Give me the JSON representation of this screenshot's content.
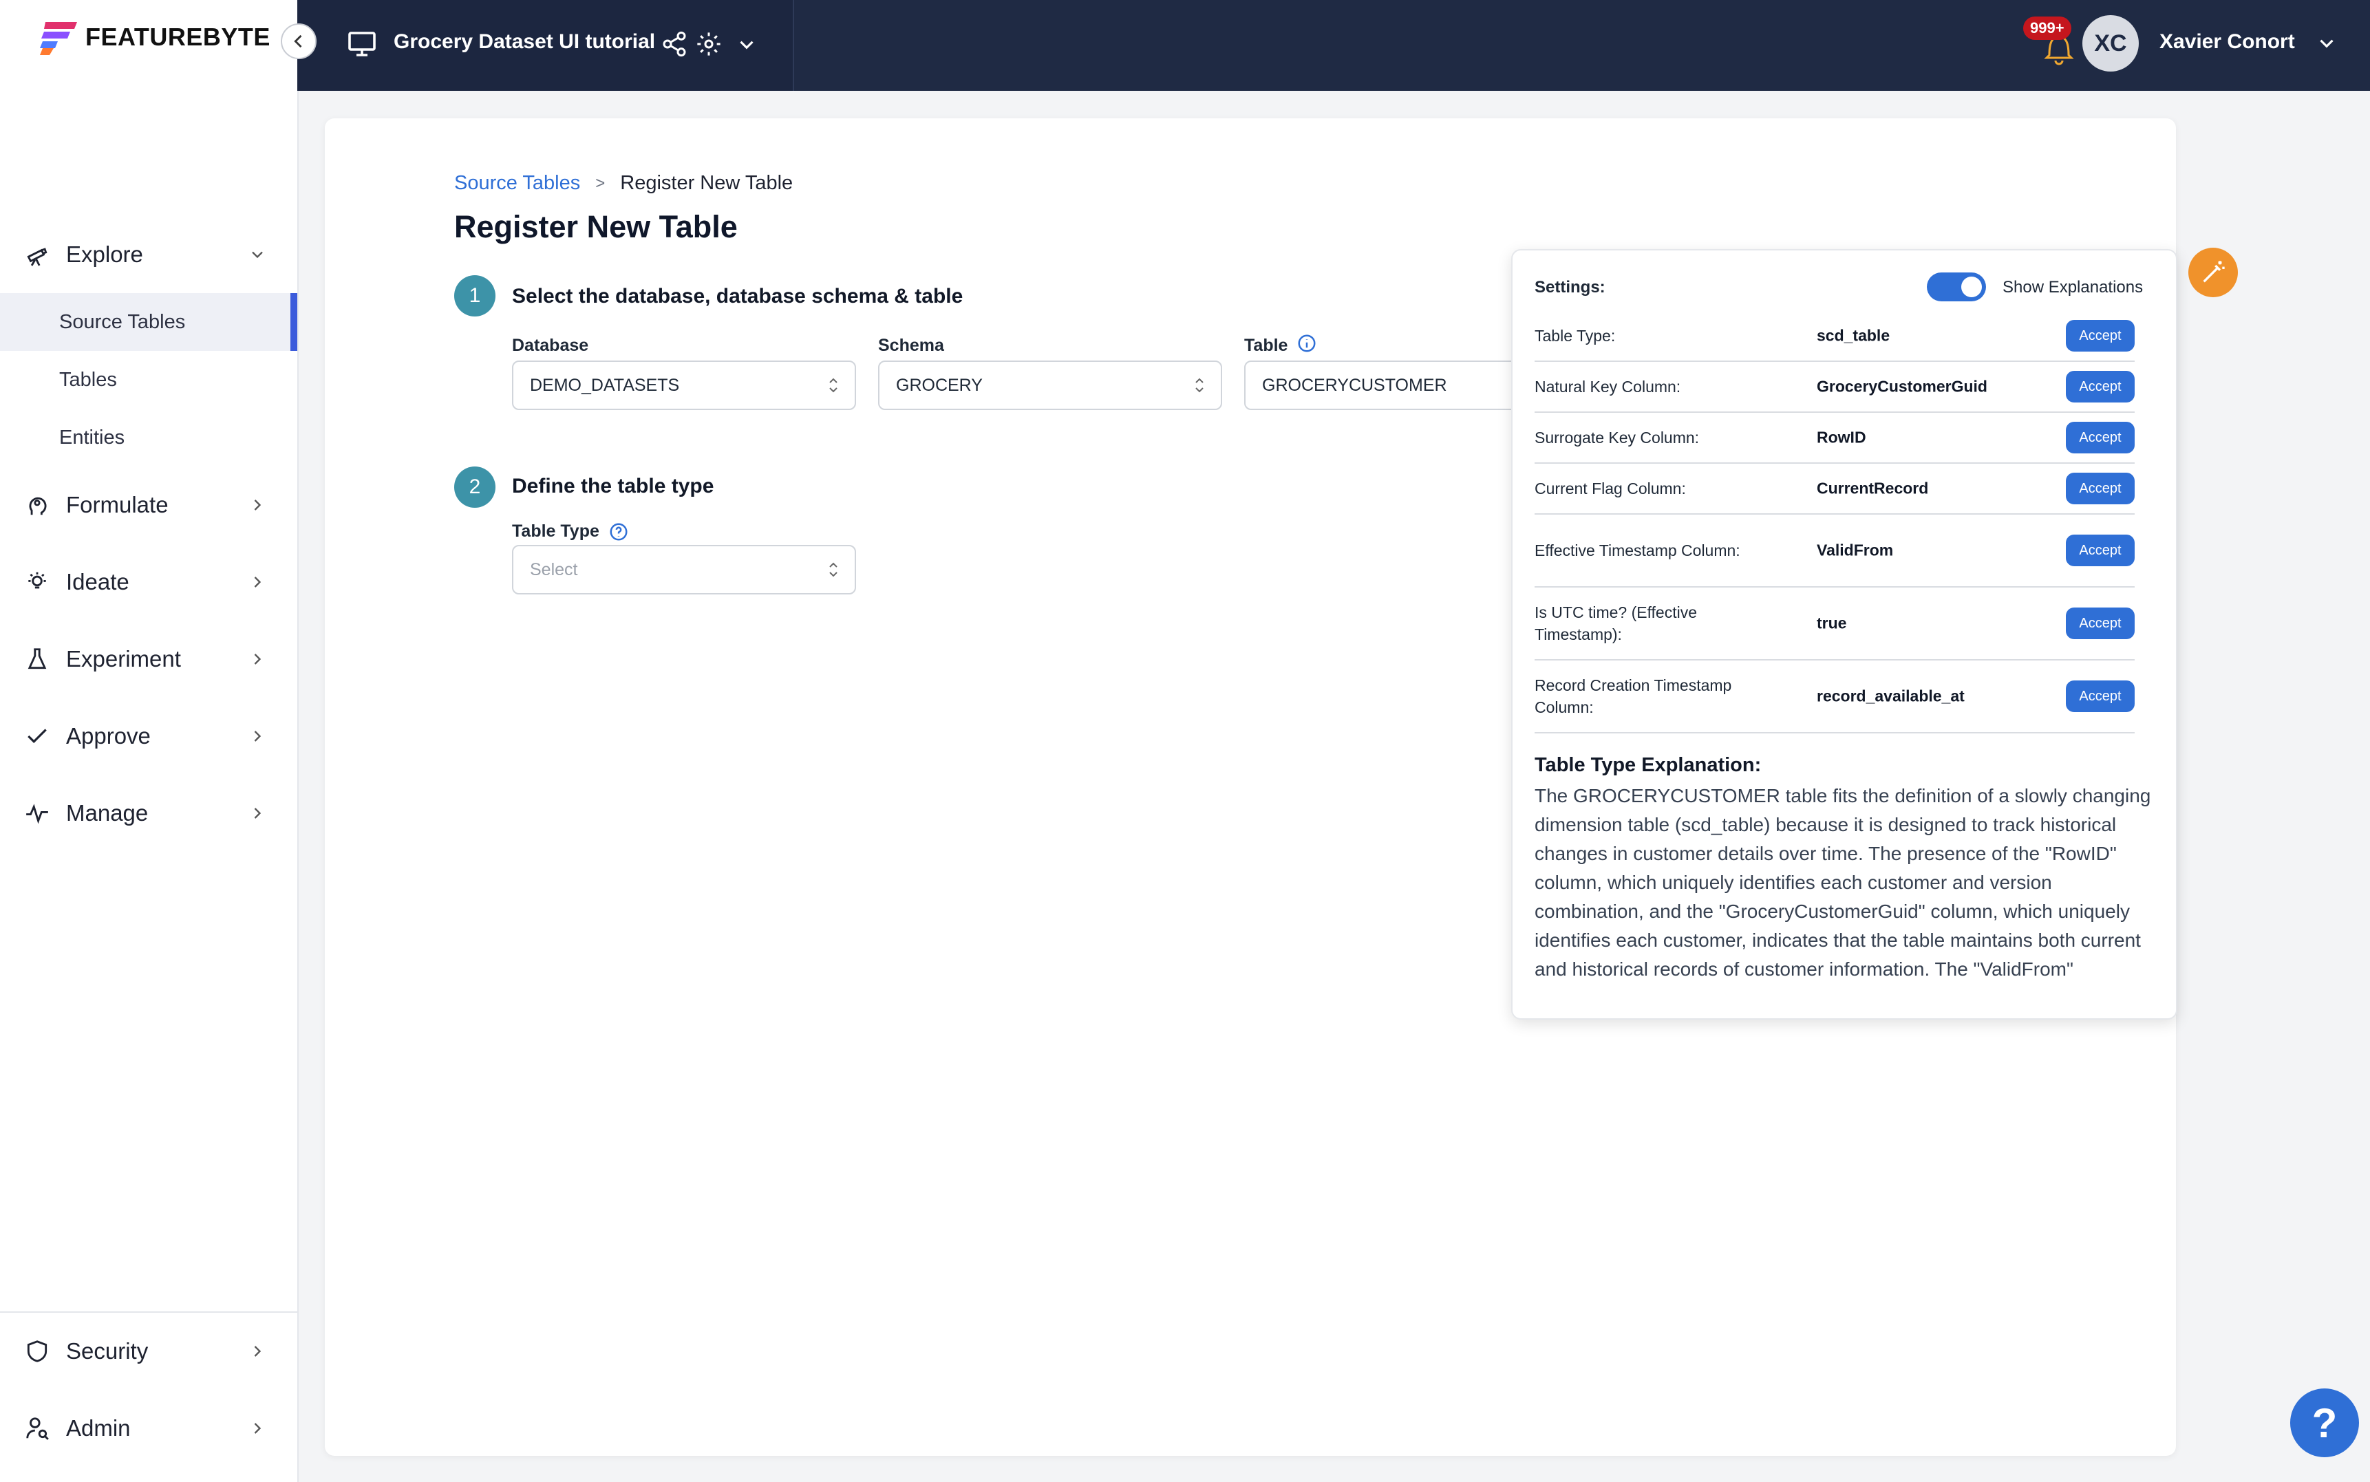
{
  "brand": {
    "name": "FEATUREBYTE",
    "accent": "#3b5bdb"
  },
  "topbar": {
    "project_title": "Grocery Dataset UI tutorial",
    "notifications_badge": "999+",
    "avatar_initials": "XC",
    "user_name": "Xavier Conort"
  },
  "sidebar": {
    "items": [
      {
        "label": "Explore",
        "icon": "telescope-icon",
        "expanded": true,
        "children": [
          {
            "label": "Source Tables",
            "active": true
          },
          {
            "label": "Tables"
          },
          {
            "label": "Entities"
          }
        ]
      },
      {
        "label": "Formulate",
        "icon": "head-icon"
      },
      {
        "label": "Ideate",
        "icon": "lightbulb-icon"
      },
      {
        "label": "Experiment",
        "icon": "flask-icon"
      },
      {
        "label": "Approve",
        "icon": "check-icon"
      },
      {
        "label": "Manage",
        "icon": "pulse-icon"
      }
    ],
    "bottom_items": [
      {
        "label": "Security",
        "icon": "shield-icon"
      },
      {
        "label": "Admin",
        "icon": "user-search-icon"
      }
    ]
  },
  "breadcrumb": {
    "parent": "Source Tables",
    "separator": ">",
    "current": "Register New Table"
  },
  "page_title": "Register New Table",
  "step1": {
    "number": "1",
    "title": "Select the database, database schema & table",
    "database_label": "Database",
    "database_value": "DEMO_DATASETS",
    "schema_label": "Schema",
    "schema_value": "GROCERY",
    "table_label": "Table",
    "table_value": "GROCERYCUSTOMER"
  },
  "step2": {
    "number": "2",
    "title": "Define the table type",
    "table_type_label": "Table Type",
    "table_type_placeholder": "Select"
  },
  "panel": {
    "settings_label": "Settings:",
    "show_explanations_label": "Show Explanations",
    "show_explanations_on": true,
    "accept_label": "Accept",
    "rows": [
      {
        "key": "Table Type:",
        "value": "scd_table"
      },
      {
        "key": "Natural Key Column:",
        "value": "GroceryCustomerGuid"
      },
      {
        "key": "Surrogate Key Column:",
        "value": "RowID"
      },
      {
        "key": "Current Flag Column:",
        "value": "CurrentRecord"
      },
      {
        "key": "Effective Timestamp Column:",
        "value": "ValidFrom"
      },
      {
        "key": "Is UTC time? (Effective Timestamp):",
        "value": "true"
      },
      {
        "key": "Record Creation Timestamp Column:",
        "value": "record_available_at"
      }
    ],
    "explanation_title": "Table Type Explanation:",
    "explanation_text": "The GROCERYCUSTOMER table fits the definition of a slowly changing dimension table (scd_table) because it is designed to track historical changes in customer details over time. The presence of the \"RowID\" column, which uniquely identifies each customer and version combination, and the \"GroceryCustomerGuid\" column, which uniquely identifies each customer, indicates that the table maintains both current and historical records of customer information. The \"ValidFrom\""
  },
  "help_label": "?"
}
